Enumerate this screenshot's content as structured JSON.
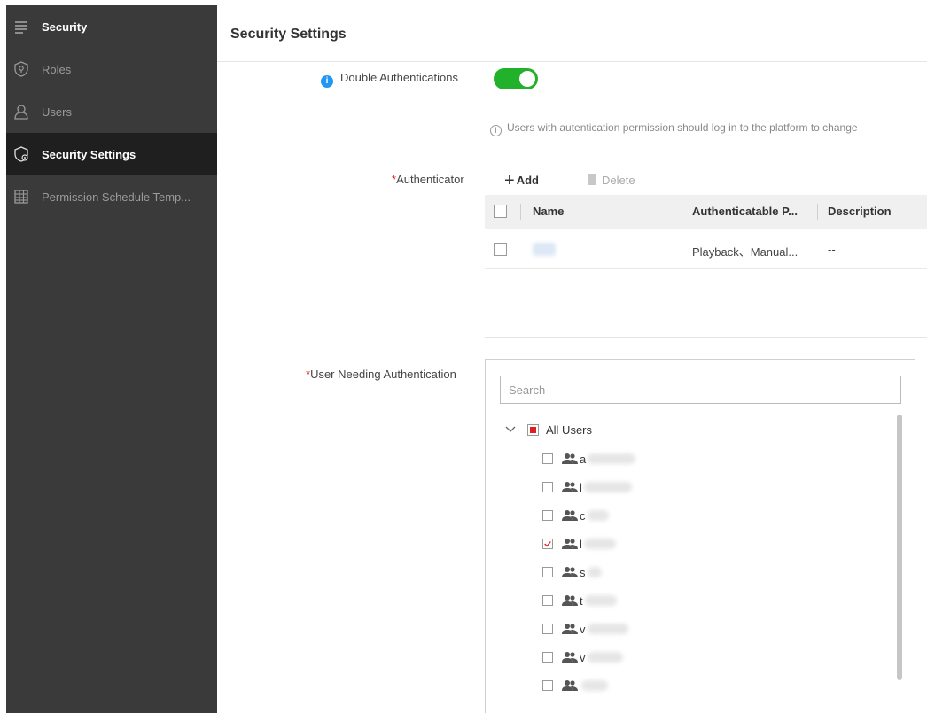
{
  "sidebar": {
    "header": {
      "label": "Security",
      "icon": "menu-icon"
    },
    "items": [
      {
        "label": "Roles",
        "icon": "shield-icon",
        "active": false
      },
      {
        "label": "Users",
        "icon": "user-icon",
        "active": false
      },
      {
        "label": "Security Settings",
        "icon": "shield-gear-icon",
        "active": true
      },
      {
        "label": "Permission Schedule Temp...",
        "icon": "table-icon",
        "active": false
      }
    ]
  },
  "page": {
    "title": "Security Settings"
  },
  "double_auth": {
    "label": "Double Authentications",
    "enabled": true,
    "hint": "Users with autentication permission should log in to the platform to change"
  },
  "authenticator": {
    "required_mark": "*",
    "label": "Authenticator",
    "add_label": "Add",
    "delete_label": "Delete",
    "columns": [
      "Name",
      "Authenticatable P...",
      "Description"
    ],
    "rows": [
      {
        "name": "",
        "permissions": "Playback、Manual...",
        "description": "--"
      }
    ]
  },
  "users_needing_auth": {
    "required_mark": "*",
    "label": "User Needing Authentication",
    "search_placeholder": "Search",
    "root_label": "All Users",
    "users": [
      {
        "initial": "a",
        "checked": false
      },
      {
        "initial": "l",
        "checked": false
      },
      {
        "initial": "c",
        "checked": false
      },
      {
        "initial": "l",
        "checked": true
      },
      {
        "initial": "s",
        "checked": false
      },
      {
        "initial": "t",
        "checked": false
      },
      {
        "initial": "v",
        "checked": false
      },
      {
        "initial": "v",
        "checked": false
      },
      {
        "initial": "",
        "checked": false
      }
    ]
  },
  "colors": {
    "toggle_on": "#22b12a",
    "sidebar_bg": "#3a3a3a",
    "sidebar_active": "#1f1f1f",
    "info_blue": "#2196f3",
    "required_red": "#e02020"
  }
}
